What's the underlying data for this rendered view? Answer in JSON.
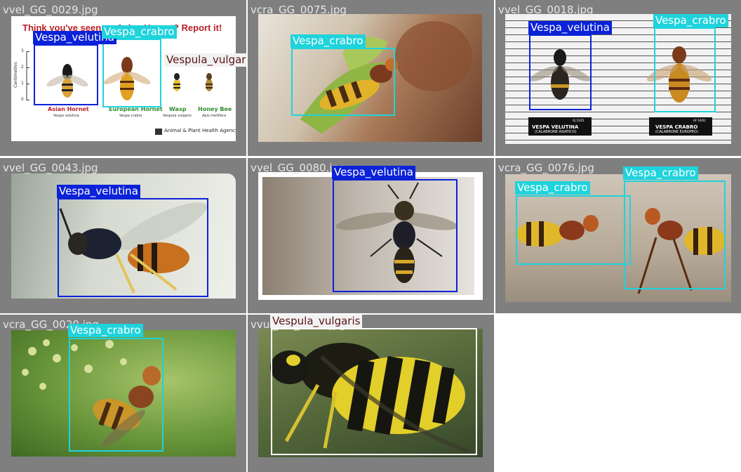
{
  "tiles": [
    {
      "filename": "vvel_GG_0029.jpg",
      "poster": {
        "heading": "Think you've seen an Asian Hornet? Report it!",
        "axis_label": "Centimetres",
        "ticks": [
          "3",
          "2",
          "1",
          "0"
        ],
        "species": [
          {
            "name": "Asian Hornet",
            "latin": "Vespa velutina"
          },
          {
            "name": "European Hornet",
            "latin": "Vespa crabro"
          },
          {
            "name": "Wasp",
            "latin": "Vespula vulgaris"
          },
          {
            "name": "Honey Bee",
            "latin": "Apis mellifera"
          }
        ],
        "agency": "Animal & Plant Health Agency"
      },
      "labels": [
        "Vespa_velutina",
        "Vespa_crabro",
        "Vespula_vulgaris"
      ]
    },
    {
      "filename": "vcra_GG_0075.jpg",
      "labels": [
        "Vespa_crabro"
      ]
    },
    {
      "filename": "vvel_GG_0018.jpg",
      "plates": [
        {
          "line1": "AJ 15/01",
          "line2": "VESPA VELUTINA",
          "line3": "(CALABRONE ASIATICO)"
        },
        {
          "line1": "AF 16/02",
          "line2": "VESPA CRABRO",
          "line3": "(CALABRONE EUROPEO)"
        }
      ],
      "labels": [
        "Vespa_velutina",
        "Vespa_crabro"
      ]
    },
    {
      "filename": "vvel_GG_0043.jpg",
      "labels": [
        "Vespa_velutina"
      ]
    },
    {
      "filename": "vvel_GG_0080.jpg",
      "labels": [
        "Vespa_velutina"
      ]
    },
    {
      "filename": "vcra_GG_0076.jpg",
      "labels": [
        "Vespa_crabro",
        "Vespa_crabro"
      ]
    },
    {
      "filename": "vcra_GG_0020.jpg",
      "labels": [
        "Vespa_crabro"
      ]
    },
    {
      "filename": "vvul_GG_0016.jpg",
      "labels": [
        "Vespula_vulgaris"
      ]
    }
  ],
  "colors": {
    "Vespa_velutina": "#0b22d8",
    "Vespa_crabro": "#1fd3dc",
    "Vespula_vulgaris": "#ffffff",
    "tile_background": "#7f7f7f"
  }
}
